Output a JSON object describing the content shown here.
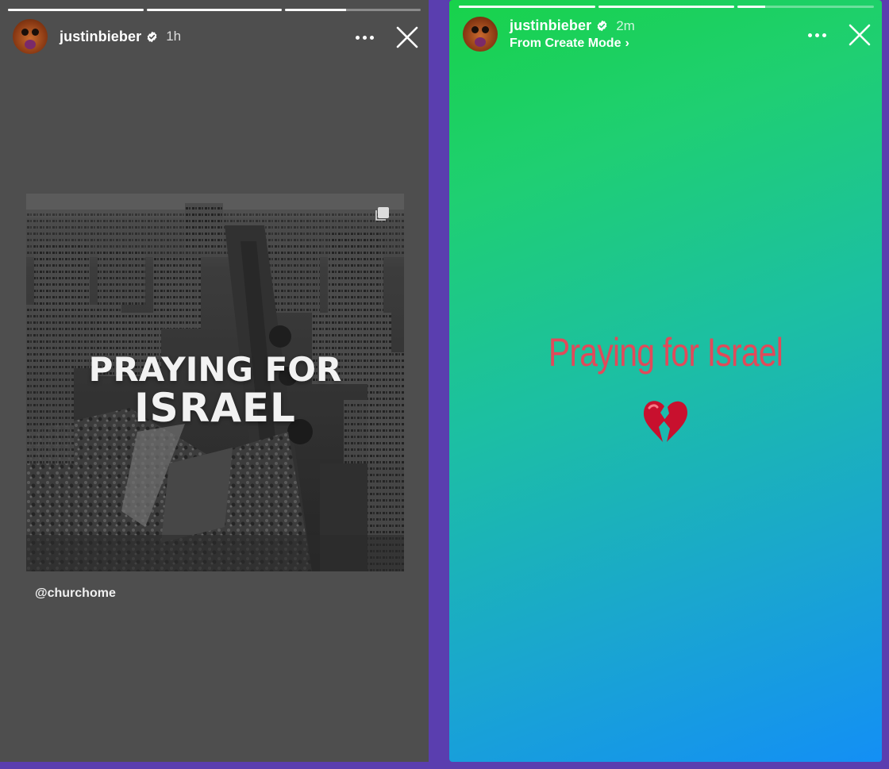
{
  "left_story": {
    "progress": [
      1.0,
      1.0,
      0.45
    ],
    "username": "justinbieber",
    "time": "1h",
    "post": {
      "line1": "PRAYING FOR",
      "line2": "ISRAEL"
    },
    "mention": "@churchome"
  },
  "right_story": {
    "progress": [
      1.0,
      1.0,
      0.2
    ],
    "username": "justinbieber",
    "time": "2m",
    "subtitle": "From Create Mode",
    "text": "Praying for Israel",
    "emoji_icon": "broken-heart-icon",
    "text_color": "#e04a5a"
  },
  "colors": {
    "frame": "#5a3eaf",
    "left_bg": "#4e4e4e",
    "gradient_top": "#18d24a",
    "gradient_bottom": "#138ff5"
  }
}
